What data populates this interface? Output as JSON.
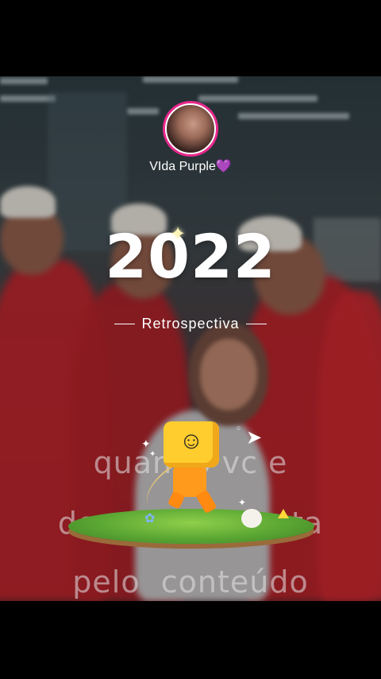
{
  "profile": {
    "username": "VIda Purple",
    "username_emoji": "💜"
  },
  "retrospective": {
    "year": "2022",
    "label": "Retrospectiva"
  },
  "video": {
    "caption_lines": [
      "quando vc e",
      "dora              sta",
      "pelo  conteúdo"
    ]
  },
  "icons": {
    "sparkle": "sparkle-icon",
    "paper_plane": "paper-plane-icon",
    "mascot": "mascot-icon"
  },
  "colors": {
    "avatar_ring": "#e8288c",
    "heart": "#a25ee8",
    "suit_red": "#b8232a",
    "mascot_yellow": "#ffcd2e"
  }
}
